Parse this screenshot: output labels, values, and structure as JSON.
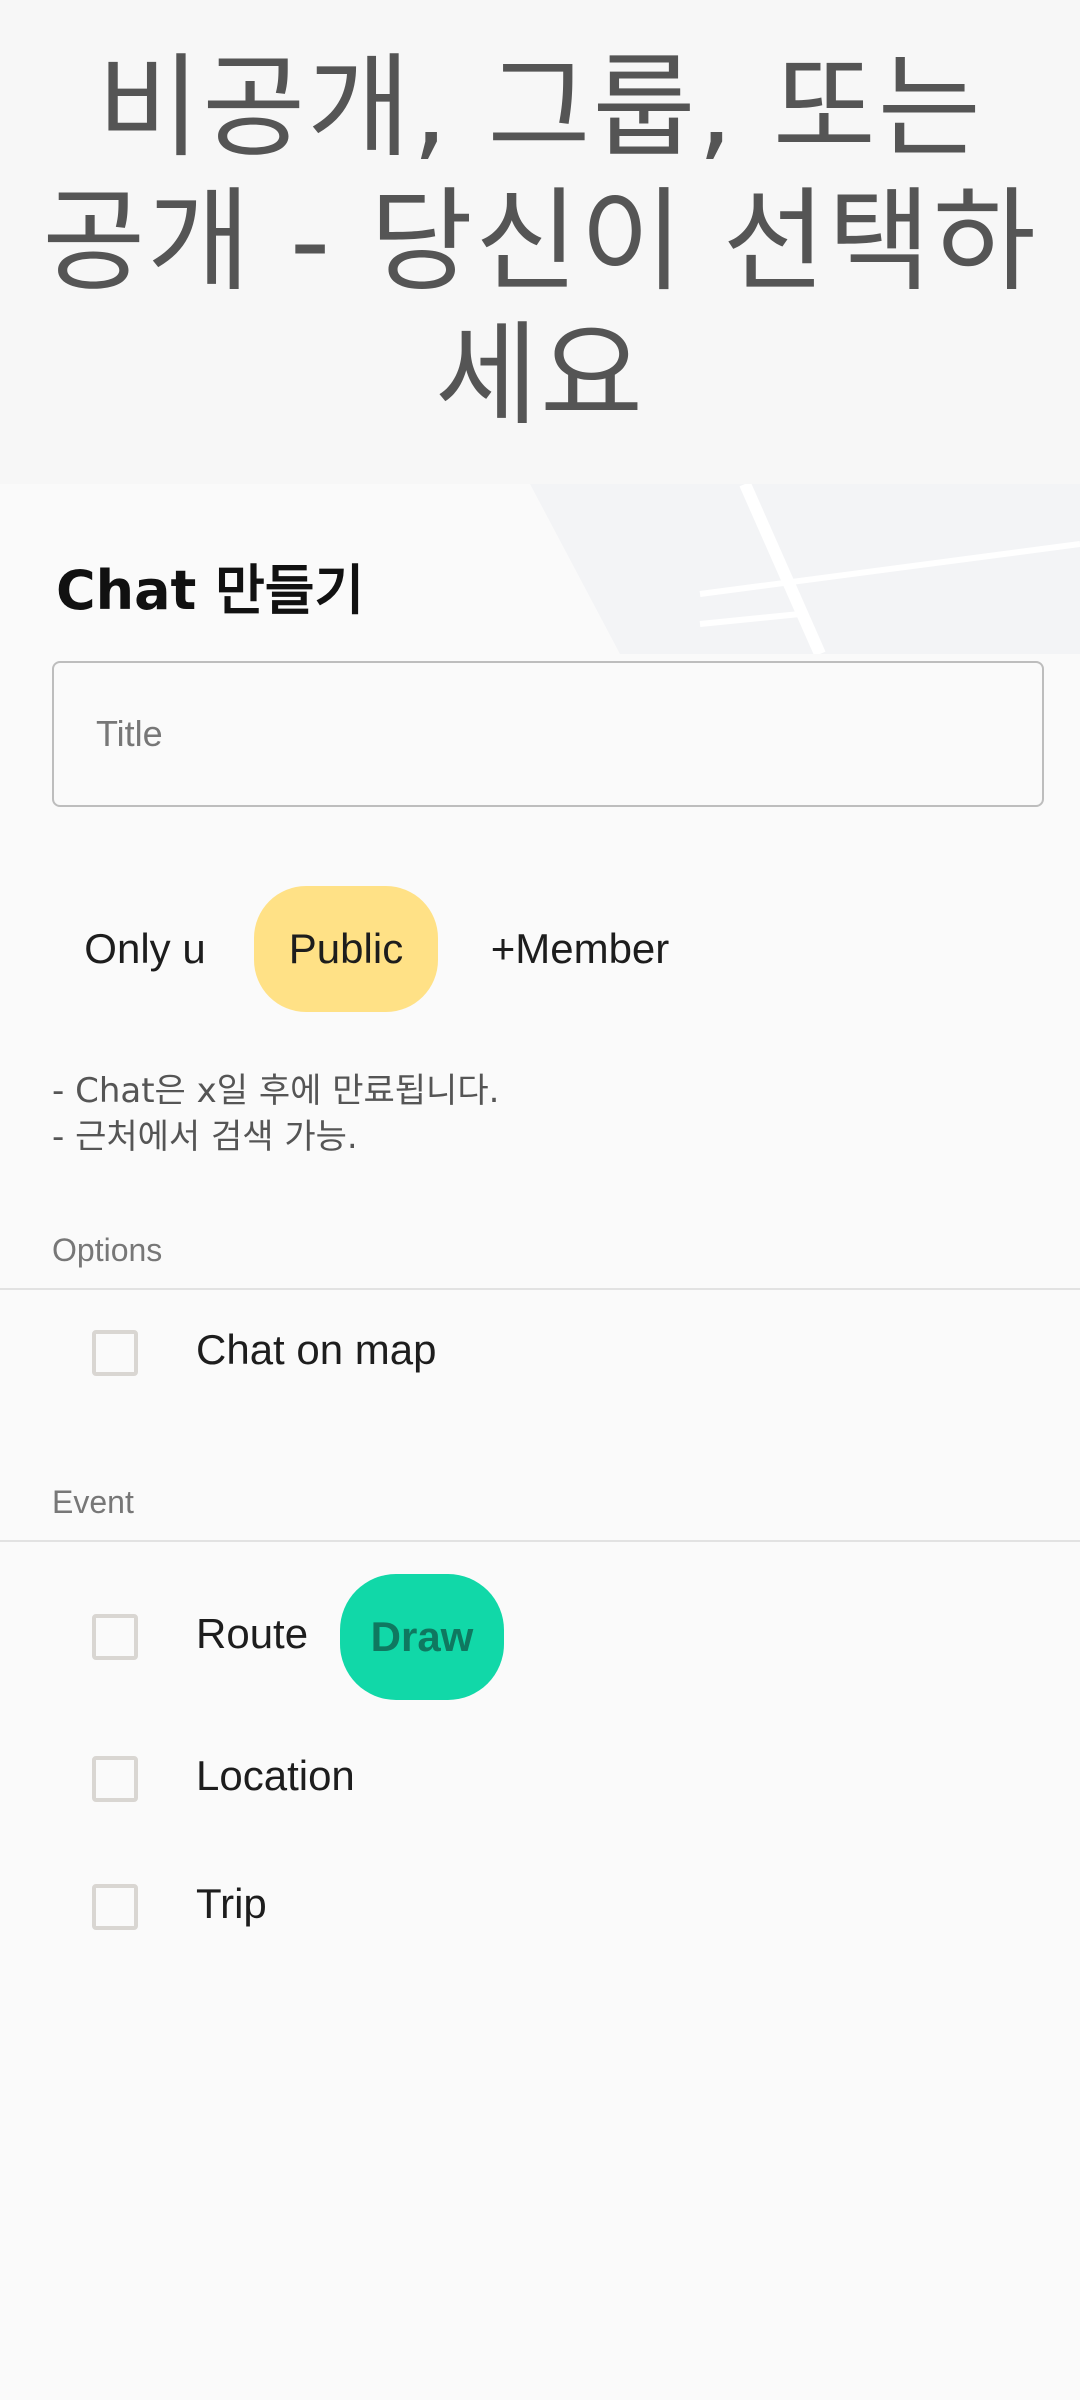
{
  "hero": {
    "title": "비공개, 그룹, 또는 공개 - 당신이 선택하세요"
  },
  "form": {
    "heading": "Chat 만들기",
    "title_field": {
      "placeholder": "Title",
      "value": ""
    },
    "visibility": {
      "options": [
        "Only u",
        "Public",
        "+Member"
      ],
      "selected": "Public",
      "selected_color": "#ffe186"
    },
    "description": [
      "- Chat은 x일 후에 만료됩니다.",
      "- 근처에서 검색 가능."
    ]
  },
  "options_section": {
    "header": "Options",
    "items": [
      {
        "label": "Chat on map",
        "checked": false
      }
    ]
  },
  "event_section": {
    "header": "Event",
    "items": [
      {
        "label": "Route",
        "checked": false
      },
      {
        "label": "Location",
        "checked": false
      },
      {
        "label": "Trip",
        "checked": false
      }
    ],
    "draw_button": {
      "label": "Draw",
      "color": "#11d8a8"
    }
  }
}
